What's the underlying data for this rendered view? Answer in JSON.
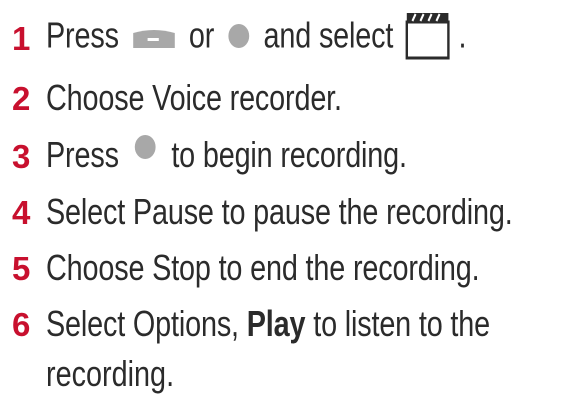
{
  "steps": [
    {
      "num": "1",
      "parts": {
        "a": "Press",
        "b": "or",
        "c": "and select",
        "d": "."
      },
      "icons": [
        "soft-key-left-icon",
        "ok-key-icon",
        "multimedia-clapperboard-icon"
      ]
    },
    {
      "num": "2",
      "text": "Choose Voice recorder."
    },
    {
      "num": "3",
      "parts": {
        "a": "Press",
        "b": "to begin recording."
      },
      "icons": [
        "ok-key-icon"
      ]
    },
    {
      "num": "4",
      "text": "Select Pause to pause the recording."
    },
    {
      "num": "5",
      "text": "Choose Stop to end the recording."
    },
    {
      "num": "6",
      "parts": {
        "a": "Select Options,",
        "bold": "Play",
        "b": "to listen to the",
        "cont": "recording."
      }
    }
  ],
  "colors": {
    "number": "#c8102e",
    "text": "#2b2b2b",
    "key": "#a8a8a8"
  }
}
